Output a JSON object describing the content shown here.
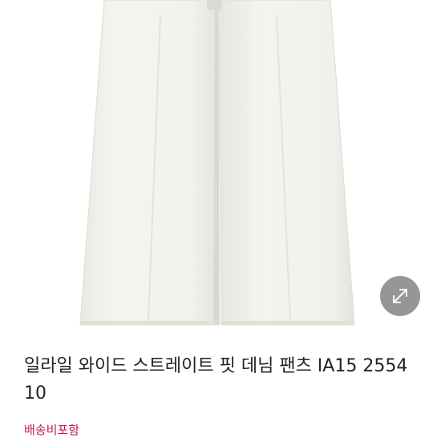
{
  "product": {
    "title": "일라일 와이드 스트레이트 핏 데님 팬츠 IA15 255410",
    "shipping_label": "배송비포함"
  },
  "icons": {
    "expand": "expand-diagonal-arrows-icon"
  },
  "colors": {
    "shipping_accent": "#c2185b",
    "pants": "#f3f3ee",
    "expand_button": "#6e6e6e"
  }
}
